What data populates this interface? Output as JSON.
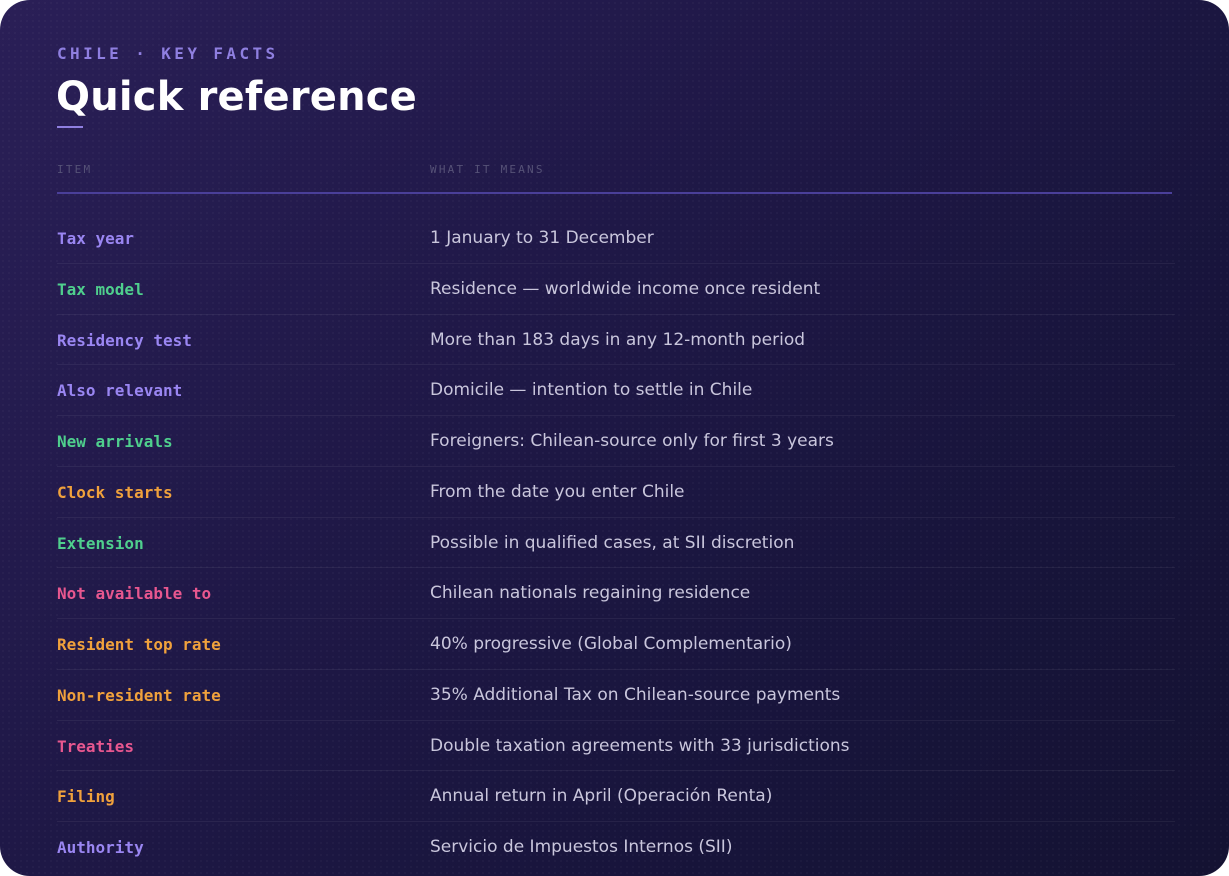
{
  "eyebrow": "CHILE · KEY FACTS",
  "title": "Quick reference",
  "columns": {
    "item": "ITEM",
    "means": "WHAT IT MEANS"
  },
  "colors": {
    "violet": "#9a86f2",
    "green": "#4fcf8d",
    "orange": "#f0a13c",
    "pink": "#e8578f"
  },
  "rows": [
    {
      "label": "Tax year",
      "value": "1 January to 31 December",
      "color": "#9a86f2"
    },
    {
      "label": "Tax model",
      "value": "Residence — worldwide income once resident",
      "color": "#4fcf8d"
    },
    {
      "label": "Residency test",
      "value": "More than 183 days in any 12-month period",
      "color": "#9a86f2"
    },
    {
      "label": "Also relevant",
      "value": "Domicile — intention to settle in Chile",
      "color": "#9a86f2"
    },
    {
      "label": "New arrivals",
      "value": "Foreigners: Chilean-source only for first 3 years",
      "color": "#4fcf8d"
    },
    {
      "label": "Clock starts",
      "value": "From the date you enter Chile",
      "color": "#f0a13c"
    },
    {
      "label": "Extension",
      "value": "Possible in qualified cases, at SII discretion",
      "color": "#4fcf8d"
    },
    {
      "label": "Not available to",
      "value": "Chilean nationals regaining residence",
      "color": "#e8578f"
    },
    {
      "label": "Resident top rate",
      "value": "40% progressive (Global Complementario)",
      "color": "#f0a13c"
    },
    {
      "label": "Non-resident rate",
      "value": "35% Additional Tax on Chilean-source payments",
      "color": "#f0a13c"
    },
    {
      "label": "Treaties",
      "value": "Double taxation agreements with 33 jurisdictions",
      "color": "#e8578f"
    },
    {
      "label": "Filing",
      "value": "Annual return in April (Operación Renta)",
      "color": "#f0a13c"
    },
    {
      "label": "Authority",
      "value": "Servicio de Impuestos Internos (SII)",
      "color": "#9a86f2"
    }
  ]
}
